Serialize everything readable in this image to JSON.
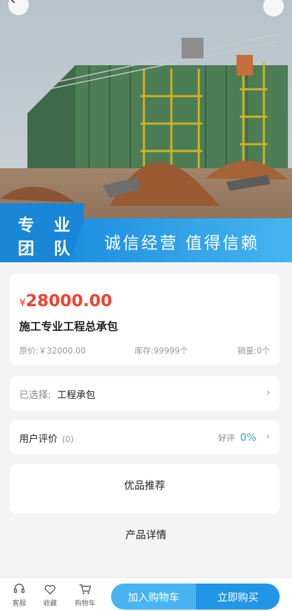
{
  "hero": {
    "badge_line1": "专 业",
    "badge_line2": "团 队",
    "slogan": "诚信经营  值得信赖"
  },
  "product": {
    "currency": "¥",
    "price": "28000.00",
    "name": "施工专业工程总承包",
    "original_price": "原价:￥32000.00",
    "stock": "库存:99999个",
    "sales": "销量:0个"
  },
  "selection": {
    "label": "已选择:",
    "value": "工程承包"
  },
  "reviews": {
    "label": "用户评价",
    "count": "(0)",
    "good_label": "好评",
    "good_rate": "0%"
  },
  "recommend": {
    "title": "优品推荐"
  },
  "detail": {
    "title": "产品详情"
  },
  "bottom_bar": {
    "service": "客服",
    "favorite": "收藏",
    "cart": "购物车",
    "add_to_cart": "加入购物车",
    "buy_now": "立即购买"
  },
  "colors": {
    "price": "#f0422c",
    "accent": "#2196e6",
    "accent_light": "#49b4f4"
  }
}
